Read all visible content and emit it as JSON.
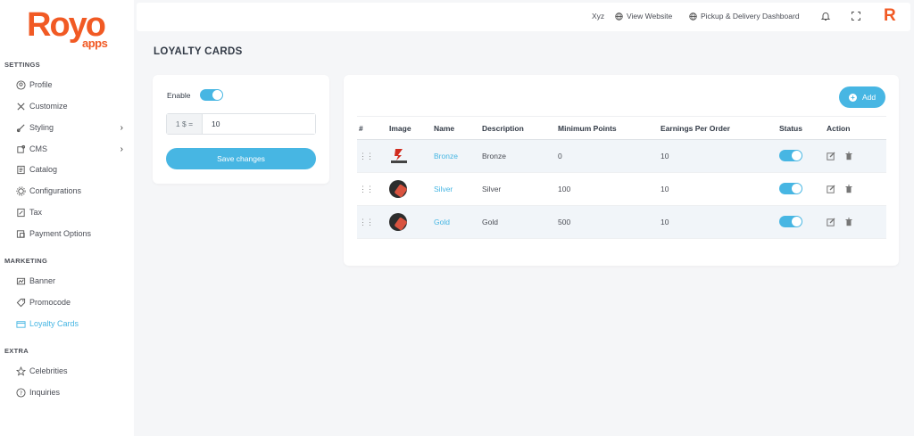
{
  "brand": {
    "name": "Royo",
    "sub": "apps",
    "accent": "#f15a24",
    "primary": "#47b6e3"
  },
  "header": {
    "user": "Xyz",
    "view_website": "View Website",
    "dashboard": "Pickup & Delivery Dashboard",
    "avatar_letter": "R"
  },
  "sidebar": {
    "settings_title": "SETTINGS",
    "settings": [
      {
        "label": "Profile",
        "icon": "user-circle-icon"
      },
      {
        "label": "Customize",
        "icon": "tools-icon"
      },
      {
        "label": "Styling",
        "icon": "brush-icon",
        "chevron": true
      },
      {
        "label": "CMS",
        "icon": "puzzle-icon",
        "chevron": true
      },
      {
        "label": "Catalog",
        "icon": "catalog-icon"
      },
      {
        "label": "Configurations",
        "icon": "gear-icon"
      },
      {
        "label": "Tax",
        "icon": "tax-icon"
      },
      {
        "label": "Payment Options",
        "icon": "payment-icon"
      }
    ],
    "marketing_title": "MARKETING",
    "marketing": [
      {
        "label": "Banner",
        "icon": "banner-icon"
      },
      {
        "label": "Promocode",
        "icon": "promocode-icon"
      },
      {
        "label": "Loyalty Cards",
        "icon": "card-icon",
        "active": true
      }
    ],
    "extra_title": "EXTRA",
    "extra": [
      {
        "label": "Celebrities",
        "icon": "star-icon"
      },
      {
        "label": "Inquiries",
        "icon": "question-icon"
      }
    ]
  },
  "page": {
    "title": "LOYALTY CARDS"
  },
  "settings_card": {
    "enable_label": "Enable",
    "enabled": true,
    "rate_prefix": "1 $ =",
    "rate_value": "10",
    "save_label": "Save changes"
  },
  "table": {
    "add_label": "Add",
    "columns": [
      "#",
      "Image",
      "Name",
      "Description",
      "Minimum Points",
      "Earnings Per Order",
      "Status",
      "Action"
    ],
    "rows": [
      {
        "name": "Bronze",
        "description": "Bronze",
        "min_points": "0",
        "earnings": "10",
        "status": true
      },
      {
        "name": "Silver",
        "description": "Silver",
        "min_points": "100",
        "earnings": "10",
        "status": true
      },
      {
        "name": "Gold",
        "description": "Gold",
        "min_points": "500",
        "earnings": "10",
        "status": true
      }
    ]
  }
}
